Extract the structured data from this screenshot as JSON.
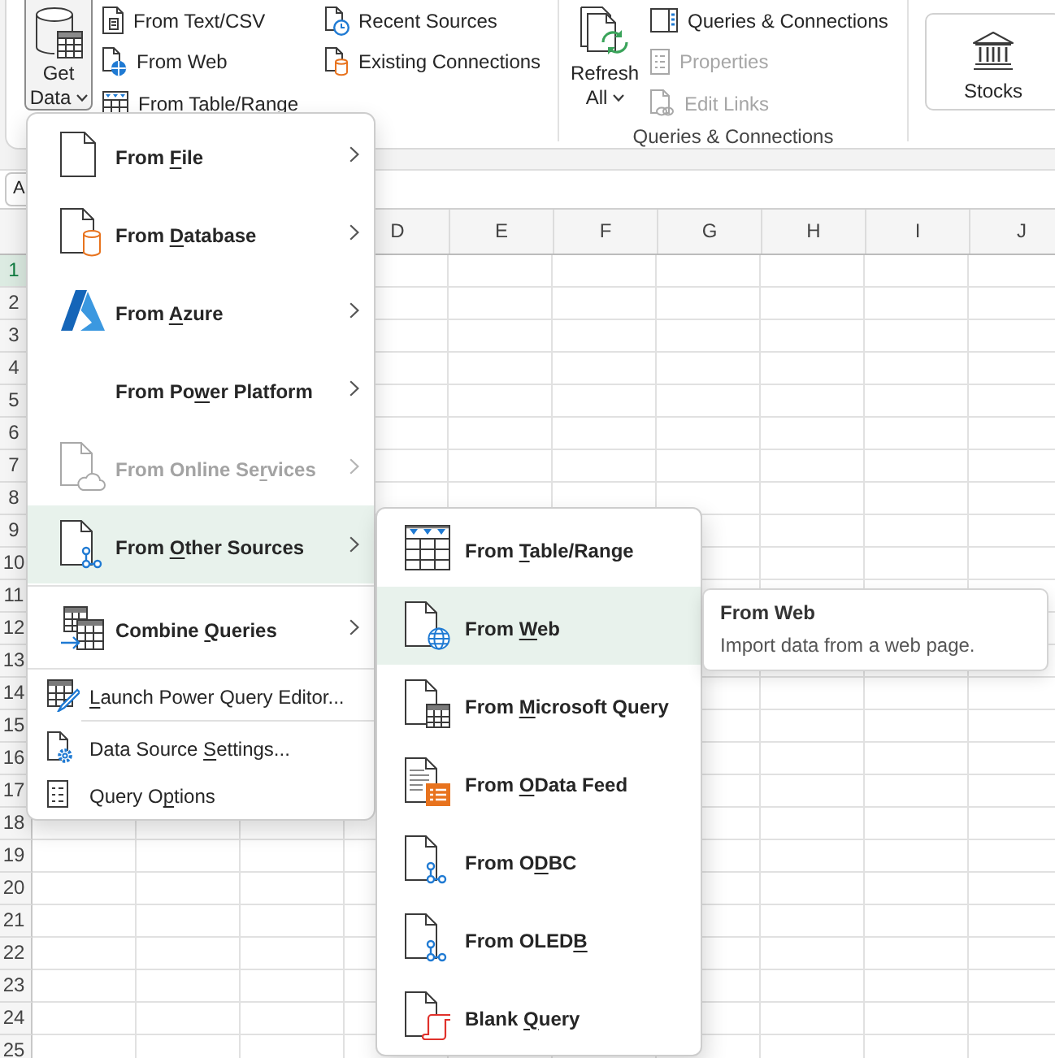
{
  "ribbon": {
    "get_data": {
      "label": "Get Data",
      "expanded": true
    },
    "get_commands": [
      {
        "label": "From Text/CSV"
      },
      {
        "label": "From Web"
      },
      {
        "label": "From Table/Range"
      },
      {
        "label": "Recent Sources"
      },
      {
        "label": "Existing Connections"
      }
    ],
    "refresh_all": {
      "label": "Refresh All"
    },
    "query_commands": [
      {
        "label": "Queries & Connections",
        "disabled": false
      },
      {
        "label": "Properties",
        "disabled": true
      },
      {
        "label": "Edit Links",
        "disabled": true
      }
    ],
    "queries_group_label": "Queries & Connections",
    "stocks": {
      "label": "Stocks"
    }
  },
  "name_box": {
    "value": "A"
  },
  "grid": {
    "columns": [
      "D",
      "E",
      "F",
      "G",
      "H",
      "I",
      "J"
    ],
    "rows": [
      {
        "label": "1",
        "selected": true
      },
      {
        "label": "2",
        "selected": false
      },
      {
        "label": "3",
        "selected": false
      },
      {
        "label": "4",
        "selected": false
      },
      {
        "label": "5",
        "selected": false
      },
      {
        "label": "6",
        "selected": false
      },
      {
        "label": "7",
        "selected": false
      },
      {
        "label": "8",
        "selected": false
      },
      {
        "label": "9",
        "selected": false
      },
      {
        "label": "10",
        "selected": false
      },
      {
        "label": "11",
        "selected": false
      },
      {
        "label": "12",
        "selected": false
      },
      {
        "label": "13",
        "selected": false
      },
      {
        "label": "14",
        "selected": false
      },
      {
        "label": "15",
        "selected": false
      },
      {
        "label": "16",
        "selected": false
      },
      {
        "label": "17",
        "selected": false
      },
      {
        "label": "18",
        "selected": false
      },
      {
        "label": "19",
        "selected": false
      },
      {
        "label": "20",
        "selected": false
      },
      {
        "label": "21",
        "selected": false
      },
      {
        "label": "22",
        "selected": false
      },
      {
        "label": "23",
        "selected": false
      },
      {
        "label": "24",
        "selected": false
      },
      {
        "label": "25",
        "selected": false
      }
    ]
  },
  "get_data_menu": {
    "sections": [
      {
        "items": [
          {
            "kind": "submenu",
            "text_before": "From ",
            "access_key": "F",
            "text_after": "ile",
            "selected": false,
            "disabled": false
          },
          {
            "kind": "submenu",
            "text_before": "From ",
            "access_key": "D",
            "text_after": "atabase",
            "selected": false,
            "disabled": false
          },
          {
            "kind": "submenu",
            "text_before": "From ",
            "access_key": "A",
            "text_after": "zure",
            "selected": false,
            "disabled": false
          },
          {
            "kind": "submenu",
            "text_before": "From Po",
            "access_key": "w",
            "text_after": "er Platform",
            "selected": false,
            "disabled": false
          },
          {
            "kind": "submenu",
            "text_before": "From Online Se",
            "access_key": "r",
            "text_after": "vices",
            "selected": false,
            "disabled": true
          },
          {
            "kind": "submenu",
            "text_before": "From ",
            "access_key": "O",
            "text_after": "ther Sources",
            "selected": true,
            "disabled": false
          }
        ]
      },
      {
        "items": [
          {
            "kind": "submenu",
            "text_before": "Combine ",
            "access_key": "Q",
            "text_after": "ueries",
            "selected": false,
            "disabled": false
          }
        ]
      },
      {
        "items": [
          {
            "kind": "command",
            "access_key": "L",
            "text_after": "aunch Power Query Editor...",
            "selected": false,
            "disabled": false
          }
        ]
      },
      {
        "items": [
          {
            "kind": "command",
            "text_before": "Data Source ",
            "access_key": "S",
            "text_after": "ettings...",
            "selected": false,
            "disabled": false
          },
          {
            "kind": "command",
            "text_before": "Query O",
            "access_key": "p",
            "text_after": "tions",
            "selected": false,
            "disabled": false
          }
        ]
      }
    ]
  },
  "other_sources_menu": {
    "items": [
      {
        "text_before": "From ",
        "access_key": "T",
        "text_after": "able/Range",
        "selected": false
      },
      {
        "text_before": "From ",
        "access_key": "W",
        "text_after": "eb",
        "selected": true
      },
      {
        "text_before": "From ",
        "access_key": "M",
        "text_after": "icrosoft Query",
        "selected": false
      },
      {
        "text_before": "From ",
        "access_key": "O",
        "text_after": "Data Feed",
        "selected": false
      },
      {
        "text_before": "From O",
        "access_key": "D",
        "text_after": "BC",
        "selected": false
      },
      {
        "text_before": "From OLED",
        "access_key": "B",
        "selected": false
      },
      {
        "text_before": "Blank ",
        "access_key": "Q",
        "text_after": "uery",
        "selected": false
      }
    ]
  },
  "tooltip": {
    "title": "From Web",
    "description": "Import data from a web page."
  }
}
